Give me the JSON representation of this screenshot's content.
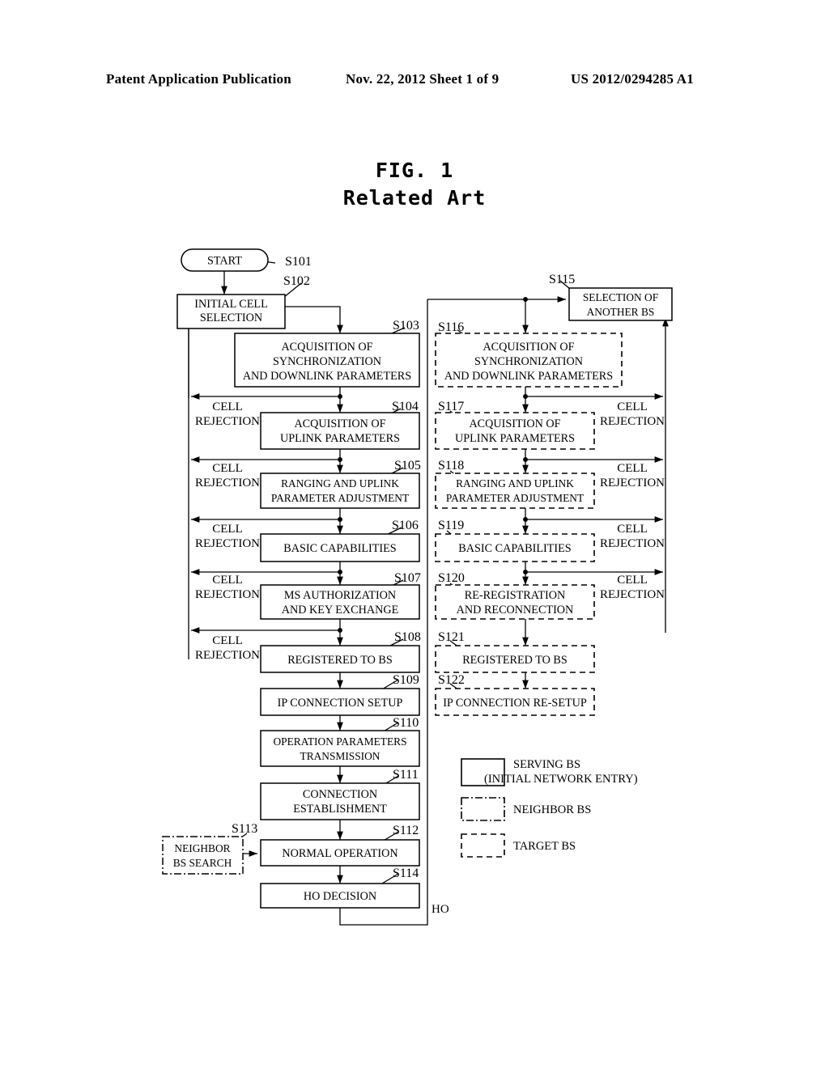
{
  "header": {
    "left": "Patent Application Publication",
    "center": "Nov. 22, 2012  Sheet 1 of 9",
    "right": "US 2012/0294285 A1"
  },
  "figure": {
    "title": "FIG. 1",
    "subtitle": "Related Art"
  },
  "nodes": {
    "start": {
      "label": "START",
      "ref": "S101"
    },
    "initial_cell_selection": {
      "l1": "INITIAL CELL",
      "l2": "SELECTION",
      "ref": "S102"
    },
    "acq_sync_dl": {
      "l1": "ACQUISITION OF",
      "l2": "SYNCHRONIZATION",
      "l3": "AND DOWNLINK PARAMETERS",
      "ref": "S103"
    },
    "acq_ul": {
      "l1": "ACQUISITION OF",
      "l2": "UPLINK PARAMETERS",
      "ref": "S104"
    },
    "ranging_ul": {
      "l1": "RANGING AND UPLINK",
      "l2": "PARAMETER ADJUSTMENT",
      "ref": "S105"
    },
    "basic_cap": {
      "l1": "BASIC CAPABILITIES",
      "ref": "S106"
    },
    "ms_auth": {
      "l1": "MS AUTHORIZATION",
      "l2": "AND KEY EXCHANGE",
      "ref": "S107"
    },
    "registered_bs": {
      "l1": "REGISTERED TO BS",
      "ref": "S108"
    },
    "ip_conn_setup": {
      "l1": "IP CONNECTION SETUP",
      "ref": "S109"
    },
    "op_params": {
      "l1": "OPERATION PARAMETERS",
      "l2": "TRANSMISSION",
      "ref": "S110"
    },
    "conn_est": {
      "l1": "CONNECTION",
      "l2": "ESTABLISHMENT",
      "ref": "S111"
    },
    "normal_op": {
      "l1": "NORMAL OPERATION",
      "ref": "S112"
    },
    "neighbor_bs_search": {
      "l1": "NEIGHBOR",
      "l2": "BS SEARCH",
      "ref": "S113"
    },
    "ho_decision": {
      "l1": "HO DECISION",
      "ref": "S114"
    },
    "selection_another_bs": {
      "l1": "SELECTION OF",
      "l2": "ANOTHER BS",
      "ref": "S115"
    },
    "t_acq_sync_dl": {
      "l1": "ACQUISITION OF",
      "l2": "SYNCHRONIZATION",
      "l3": "AND DOWNLINK PARAMETERS",
      "ref": "S116"
    },
    "t_acq_ul": {
      "l1": "ACQUISITION OF",
      "l2": "UPLINK PARAMETERS",
      "ref": "S117"
    },
    "t_ranging_ul": {
      "l1": "RANGING AND UPLINK",
      "l2": "PARAMETER ADJUSTMENT",
      "ref": "S118"
    },
    "t_basic_cap": {
      "l1": "BASIC CAPABILITIES",
      "ref": "S119"
    },
    "t_rereg": {
      "l1": "RE-REGISTRATION",
      "l2": "AND RECONNECTION",
      "ref": "S120"
    },
    "t_registered_bs": {
      "l1": "REGISTERED TO BS",
      "ref": "S121"
    },
    "t_ip_conn_resetup": {
      "l1": "IP CONNECTION RE-SETUP",
      "ref": "S122"
    }
  },
  "edge_labels": {
    "cell_rejection_l1": "CELL",
    "cell_rejection_l2": "REJECTION",
    "ho": "HO"
  },
  "legend": [
    {
      "style": "solid",
      "l1": "SERVING BS",
      "l2": "(INITIAL NETWORK ENTRY)"
    },
    {
      "style": "dashdot",
      "l1": "NEIGHBOR BS",
      "l2": ""
    },
    {
      "style": "dashed",
      "l1": "TARGET BS",
      "l2": ""
    }
  ],
  "colors": {
    "ink": "#000000",
    "paper": "#ffffff"
  }
}
